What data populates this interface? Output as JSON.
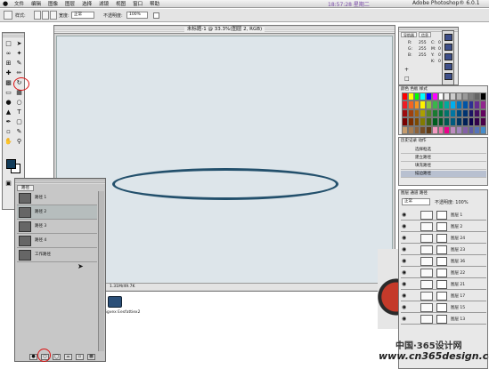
{
  "menubar": {
    "items": [
      "文件",
      "编辑",
      "图像",
      "图层",
      "选择",
      "滤镜",
      "视图",
      "窗口",
      "帮助"
    ],
    "clock": "18:57:28 星期二",
    "app": "Adobe Photoshop® 6.0.1"
  },
  "options": {
    "style_label": "样式:",
    "style_value": "正常",
    "width_label": "宽度:",
    "fill_label": "不透明度:",
    "fill_value": "100%"
  },
  "document": {
    "title": "未标题-1 @ 33.3%(图层 2, RGB)",
    "status": "1.31M/49.7K"
  },
  "desktop": {
    "file_label": "Sgvex Eesfattiex2"
  },
  "paths_palette": {
    "tab": "路径",
    "rows": [
      "路径 1",
      "路径 2",
      "路径 3",
      "路径 4",
      "工作路径"
    ],
    "selected_index": 1
  },
  "info_palette": {
    "tabs": [
      "导航器",
      "信息"
    ],
    "rgb": {
      "R": "R:",
      "G": "G:",
      "B": "B:"
    },
    "cmyk": {
      "C": "C:",
      "M": "M:",
      "Y": "Y:",
      "K": "K:"
    },
    "values": [
      "255",
      "255",
      "255",
      "0",
      "0",
      "0",
      "0"
    ]
  },
  "swatches_palette": {
    "tabs": [
      "颜色",
      "色板",
      "样式"
    ],
    "colors": [
      "#ff0000",
      "#ffff00",
      "#00ff00",
      "#00ffff",
      "#0000ff",
      "#ff00ff",
      "#ffffff",
      "#e6e6e6",
      "#cccccc",
      "#b3b3b3",
      "#999999",
      "#808080",
      "#666666",
      "#000000",
      "#ee1c24",
      "#f26522",
      "#f7941d",
      "#fff200",
      "#8dc63f",
      "#39b54a",
      "#00a651",
      "#00a99d",
      "#00aeef",
      "#0072bc",
      "#0054a6",
      "#2e3192",
      "#662d91",
      "#92278f",
      "#9e0b0f",
      "#a0410d",
      "#a36209",
      "#aba000",
      "#598527",
      "#1a7b30",
      "#007236",
      "#00746b",
      "#0076a3",
      "#004b80",
      "#003471",
      "#1b1464",
      "#440e62",
      "#630460",
      "#790000",
      "#7b2e00",
      "#7d4900",
      "#827b00",
      "#406618",
      "#005e20",
      "#005826",
      "#005952",
      "#005b7f",
      "#003663",
      "#002157",
      "#0d004c",
      "#32004b",
      "#4b0049",
      "#c69c6d",
      "#a67c52",
      "#8c6239",
      "#754c24",
      "#603913",
      "#f49ac1",
      "#f06eaa",
      "#ec008c",
      "#bd8cbf",
      "#a186be",
      "#8560a8",
      "#605ca8",
      "#5674b9",
      "#448ccb"
    ]
  },
  "actions_palette": {
    "tabs": [
      "历史记录",
      "动作"
    ],
    "rows": [
      "选择框选",
      "建立路径",
      "填充路径",
      "描边路径"
    ],
    "selected_index": 3
  },
  "layers_palette": {
    "tabs": [
      "图层",
      "通道",
      "路径"
    ],
    "mode": "正常",
    "opacity": "不透明度: 100%",
    "rows": [
      "图层 1",
      "图层 2",
      "图层 24",
      "图层 23",
      "图层 36",
      "图层 22",
      "图层 21",
      "图层 17",
      "图层 15",
      "图层 13"
    ]
  },
  "watermark": {
    "line1": "中国·365设计网",
    "line2": "www.cn365design.com"
  }
}
